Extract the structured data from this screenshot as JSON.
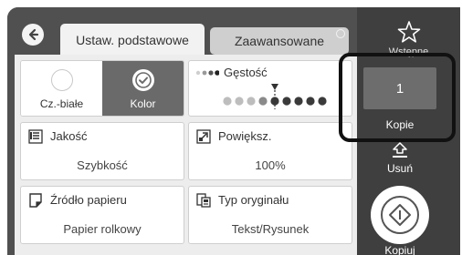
{
  "tabs": {
    "basic_label": "Ustaw. podstawowe",
    "advanced_label": "Zaawansowane"
  },
  "color_mode": {
    "mono_label": "Cz.-białe",
    "color_label": "Kolor",
    "selected": "Kolor"
  },
  "density": {
    "label": "Gęstość",
    "level": 5,
    "steps": 9
  },
  "quality": {
    "label": "Jakość",
    "value": "Szybkość"
  },
  "zoom": {
    "label": "Powiększ.",
    "value": "100%"
  },
  "paper_source": {
    "label": "Źródło papieru",
    "value": "Papier rolkowy"
  },
  "original_type": {
    "label": "Typ oryginału",
    "value": "Tekst/Rysunek"
  },
  "right_panel": {
    "favorites_label": "Wstępne",
    "copies_value": "1",
    "copies_label": "Kopie",
    "clear_label": "Usuń",
    "copy_label": "Kopiuj"
  },
  "colors": {
    "header_bg": "#505050",
    "panel_bg": "#3f3f3f",
    "selected_bg": "#6a6a6a",
    "highlight": "#111111"
  }
}
